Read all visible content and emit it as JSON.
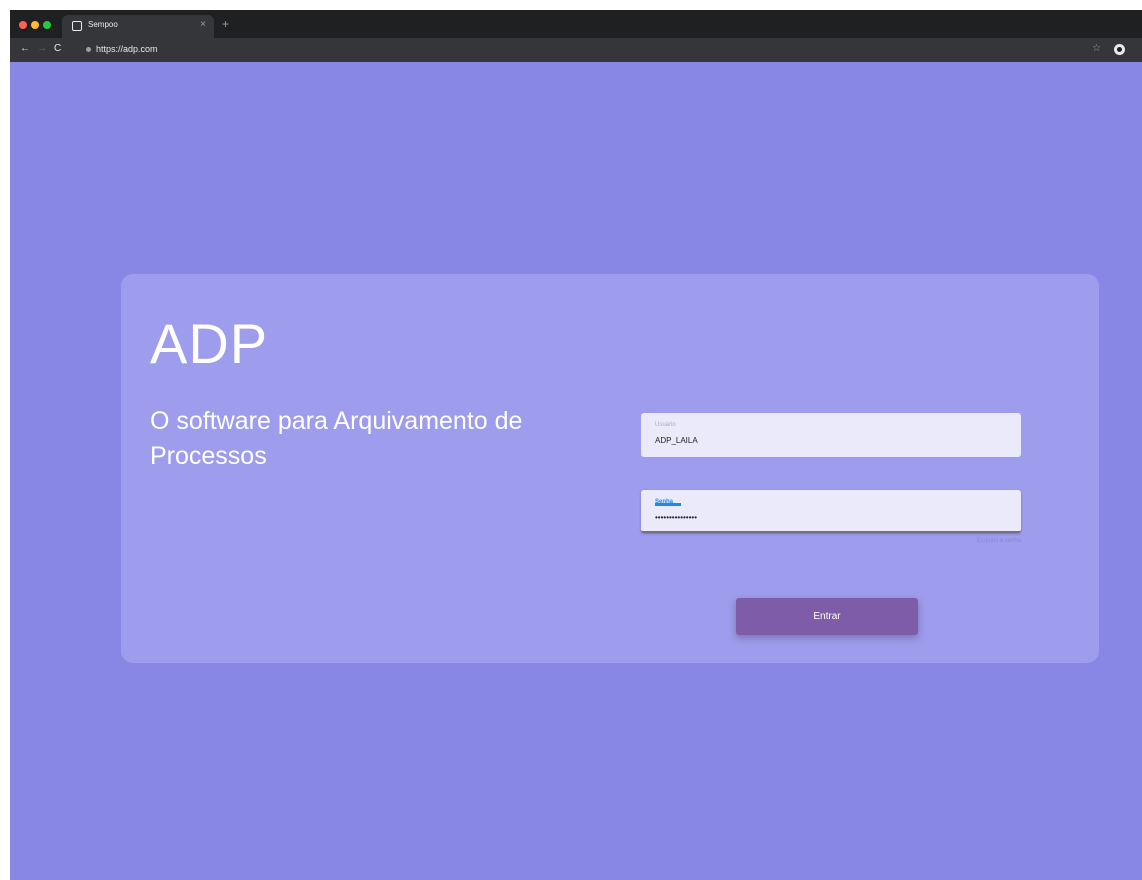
{
  "browser": {
    "tab_title": "Sempoo",
    "tab_close": "×",
    "new_tab": "+",
    "url": "https://adp.com",
    "icons": {
      "back": "←",
      "forward": "→",
      "reload": "C",
      "bookmark": "☆"
    }
  },
  "page": {
    "background_color": "#8887e6",
    "card_color": "#9e9cec",
    "brand": "ADP",
    "tagline": "O software para Arquivamento de Processos",
    "username": {
      "label": "Usuário",
      "value": "ADP_LAILA"
    },
    "password": {
      "label": "Senha",
      "value": "•••••••••••••••",
      "hint": "Esqueci a senha"
    },
    "submit_label": "Entrar",
    "button_color": "#7e5ca7"
  }
}
